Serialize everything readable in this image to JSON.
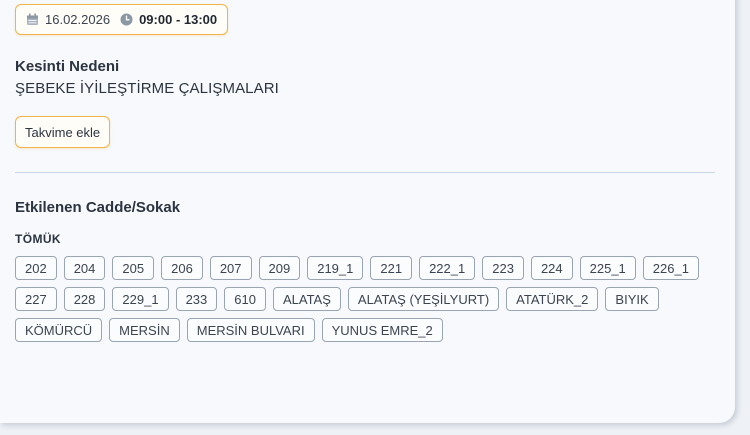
{
  "outage": {
    "date": "16.02.2026",
    "time": "09:00 - 13:00",
    "reason_label": "Kesinti Nedeni",
    "reason_value": "ŞEBEKE İYİLEŞTİRME ÇALIŞMALARI",
    "calendar_button": "Takvime ekle"
  },
  "streets": {
    "title": "Etkilenen Cadde/Sokak",
    "area": "TÖMÜK",
    "items": [
      "202",
      "204",
      "205",
      "206",
      "207",
      "209",
      "219_1",
      "221",
      "222_1",
      "223",
      "224",
      "225_1",
      "226_1",
      "227",
      "228",
      "229_1",
      "233",
      "610",
      "ALATAŞ",
      "ALATAŞ (YEŞİLYURT)",
      "ATATÜRK_2",
      "BIYIK",
      "KÖMÜRCÜ",
      "MERSİN",
      "MERSİN BULVARI",
      "YUNUS EMRE_2"
    ]
  },
  "icons": {
    "date": "calendar-icon",
    "time": "clock-icon"
  },
  "colors": {
    "accent_border": "#f0b44a",
    "divider": "#c9d6e6",
    "tag_border": "#9aa5b3"
  }
}
